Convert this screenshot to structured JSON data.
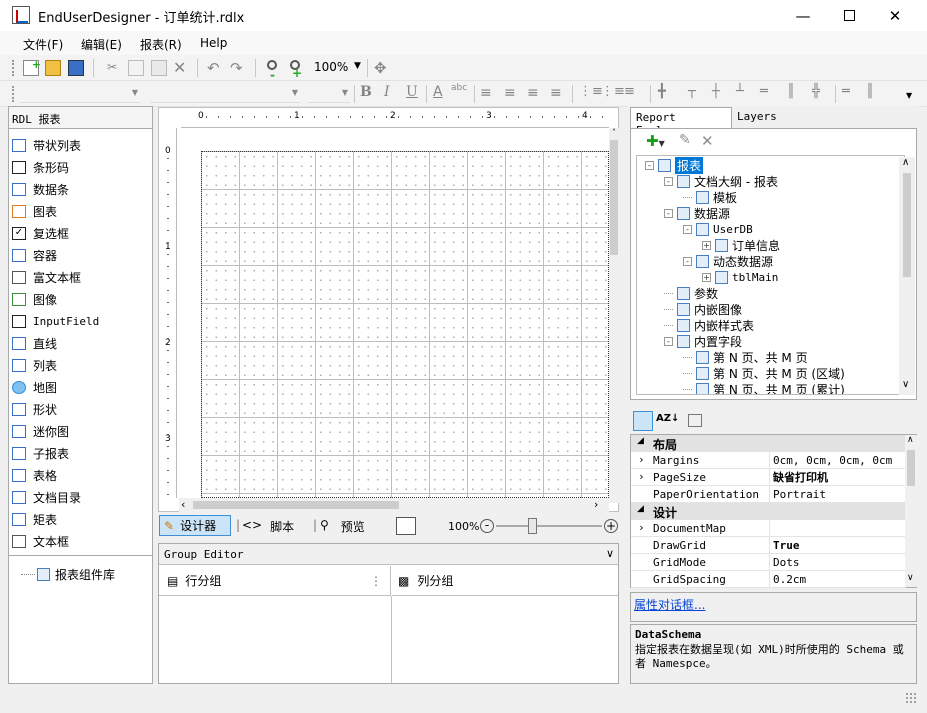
{
  "window": {
    "title": "EndUserDesigner - 订单统计.rdlx"
  },
  "menu": [
    "文件(F)",
    "编辑(E)",
    "报表(R)",
    "Help"
  ],
  "toolbar": {
    "zoom": "100%"
  },
  "left_panel": {
    "header": "RDL 报表",
    "items": [
      {
        "label": "带状列表",
        "icon": "tablix-icon"
      },
      {
        "label": "条形码",
        "icon": "barcode-icon"
      },
      {
        "label": "数据条",
        "icon": "databar-icon"
      },
      {
        "label": "图表",
        "icon": "chart-icon"
      },
      {
        "label": "复选框",
        "icon": "checkbox-icon"
      },
      {
        "label": "容器",
        "icon": "container-icon"
      },
      {
        "label": "富文本框",
        "icon": "richtext-icon"
      },
      {
        "label": "图像",
        "icon": "image-icon"
      },
      {
        "label": "InputField",
        "icon": "inputfield-icon"
      },
      {
        "label": "直线",
        "icon": "line-icon"
      },
      {
        "label": "列表",
        "icon": "list-icon"
      },
      {
        "label": "地图",
        "icon": "map-icon"
      },
      {
        "label": "形状",
        "icon": "shape-icon"
      },
      {
        "label": "迷你图",
        "icon": "sparkline-icon"
      },
      {
        "label": "子报表",
        "icon": "subreport-icon"
      },
      {
        "label": "表格",
        "icon": "table-icon"
      },
      {
        "label": "文档目录",
        "icon": "toc-icon"
      },
      {
        "label": "矩表",
        "icon": "matrix-icon"
      },
      {
        "label": "文本框",
        "icon": "textbox-icon"
      }
    ],
    "library": "报表组件库"
  },
  "ruler": {
    "h": [
      "0",
      "1",
      "2",
      "3",
      "4"
    ],
    "v": [
      "0",
      "1",
      "2",
      "3"
    ]
  },
  "viewbar": {
    "designer": "设计器",
    "script": "脚本",
    "preview": "预览",
    "zoom": "100%"
  },
  "group_editor": {
    "title": "Group Editor",
    "row_group": "行分组",
    "col_group": "列分组"
  },
  "right_panel": {
    "tabs": [
      "Report Explorer",
      "Layers"
    ],
    "tree": [
      {
        "label": "报表",
        "depth": 0,
        "exp": "-",
        "selected": true
      },
      {
        "label": "文档大纲 - 报表",
        "depth": 1,
        "exp": "-"
      },
      {
        "label": "模板",
        "depth": 2,
        "exp": ""
      },
      {
        "label": "数据源",
        "depth": 1,
        "exp": "-"
      },
      {
        "label": "UserDB",
        "depth": 2,
        "exp": "-"
      },
      {
        "label": "订单信息",
        "depth": 3,
        "exp": "+"
      },
      {
        "label": "动态数据源",
        "depth": 2,
        "exp": "-"
      },
      {
        "label": "tblMain",
        "depth": 3,
        "exp": "+"
      },
      {
        "label": "参数",
        "depth": 1,
        "exp": ""
      },
      {
        "label": "内嵌图像",
        "depth": 1,
        "exp": ""
      },
      {
        "label": "内嵌样式表",
        "depth": 1,
        "exp": ""
      },
      {
        "label": "内置字段",
        "depth": 1,
        "exp": "-"
      },
      {
        "label": "第 N 页、共 M 页",
        "depth": 2,
        "exp": ""
      },
      {
        "label": "第 N 页、共 M 页 (区域)",
        "depth": 2,
        "exp": ""
      },
      {
        "label": "第 N 页、共 M 页 (累计)",
        "depth": 2,
        "exp": ""
      }
    ],
    "props": {
      "cat1": "布局",
      "cat2": "设计",
      "rows": [
        {
          "name": "Margins",
          "value": "0cm, 0cm, 0cm, 0cm",
          "exp": true,
          "bold": false
        },
        {
          "name": "PageSize",
          "value": "缺省打印机",
          "exp": true,
          "bold": true
        },
        {
          "name": "PaperOrientation",
          "value": "Portrait",
          "exp": false,
          "bold": false
        },
        {
          "name": "DocumentMap",
          "value": "",
          "exp": true,
          "bold": false
        },
        {
          "name": "DrawGrid",
          "value": "True",
          "exp": false,
          "bold": true
        },
        {
          "name": "GridMode",
          "value": "Dots",
          "exp": false,
          "bold": false
        },
        {
          "name": "GridSpacing",
          "value": "0.2cm",
          "exp": false,
          "bold": false
        }
      ]
    },
    "link": "属性对话框...",
    "desc_title": "DataSchema",
    "desc_text": "指定报表在数据呈现(如 XML)时所使用的 Schema 或者 Namespce。"
  }
}
